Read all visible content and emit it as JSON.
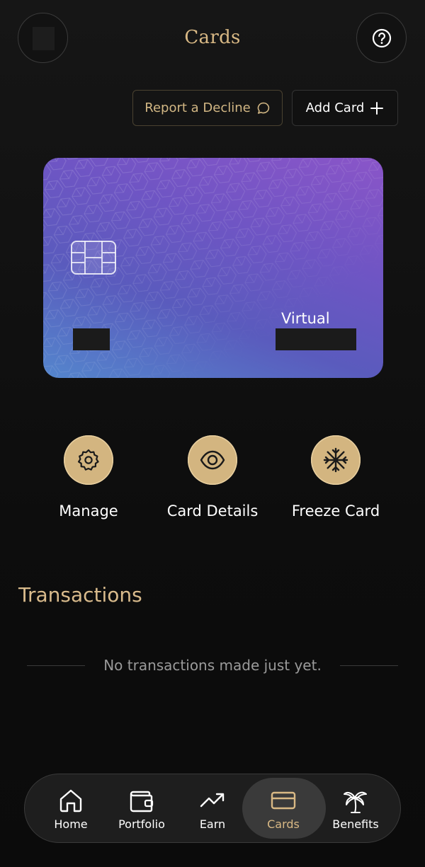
{
  "header": {
    "title": "Cards",
    "avatar_icon": "avatar-redacted",
    "help_icon": "question-circle-icon"
  },
  "actions": {
    "report_decline_label": "Report a Decline",
    "report_icon": "chat-bubble-icon",
    "add_card_label": "Add Card",
    "add_icon": "plus-icon"
  },
  "card": {
    "type_label": "Virtual",
    "gradient": [
      "#8a55c8",
      "#5486cd"
    ]
  },
  "quick_actions": [
    {
      "label": "Manage",
      "icon": "gear-icon"
    },
    {
      "label": "Card Details",
      "icon": "eye-icon"
    },
    {
      "label": "Freeze Card",
      "icon": "snowflake-icon"
    }
  ],
  "transactions": {
    "title": "Transactions",
    "empty_message": "No transactions made just yet."
  },
  "nav": {
    "items": [
      {
        "label": "Home",
        "icon": "home-icon"
      },
      {
        "label": "Portfolio",
        "icon": "wallet-icon"
      },
      {
        "label": "Earn",
        "icon": "trending-up-icon"
      },
      {
        "label": "Cards",
        "icon": "credit-card-icon",
        "active": true
      },
      {
        "label": "Benefits",
        "icon": "palm-tree-icon"
      }
    ]
  },
  "colors": {
    "accent_gold": "#d9b985",
    "background": "#0d0d0d",
    "quick_action_fill": "#d3b580"
  }
}
